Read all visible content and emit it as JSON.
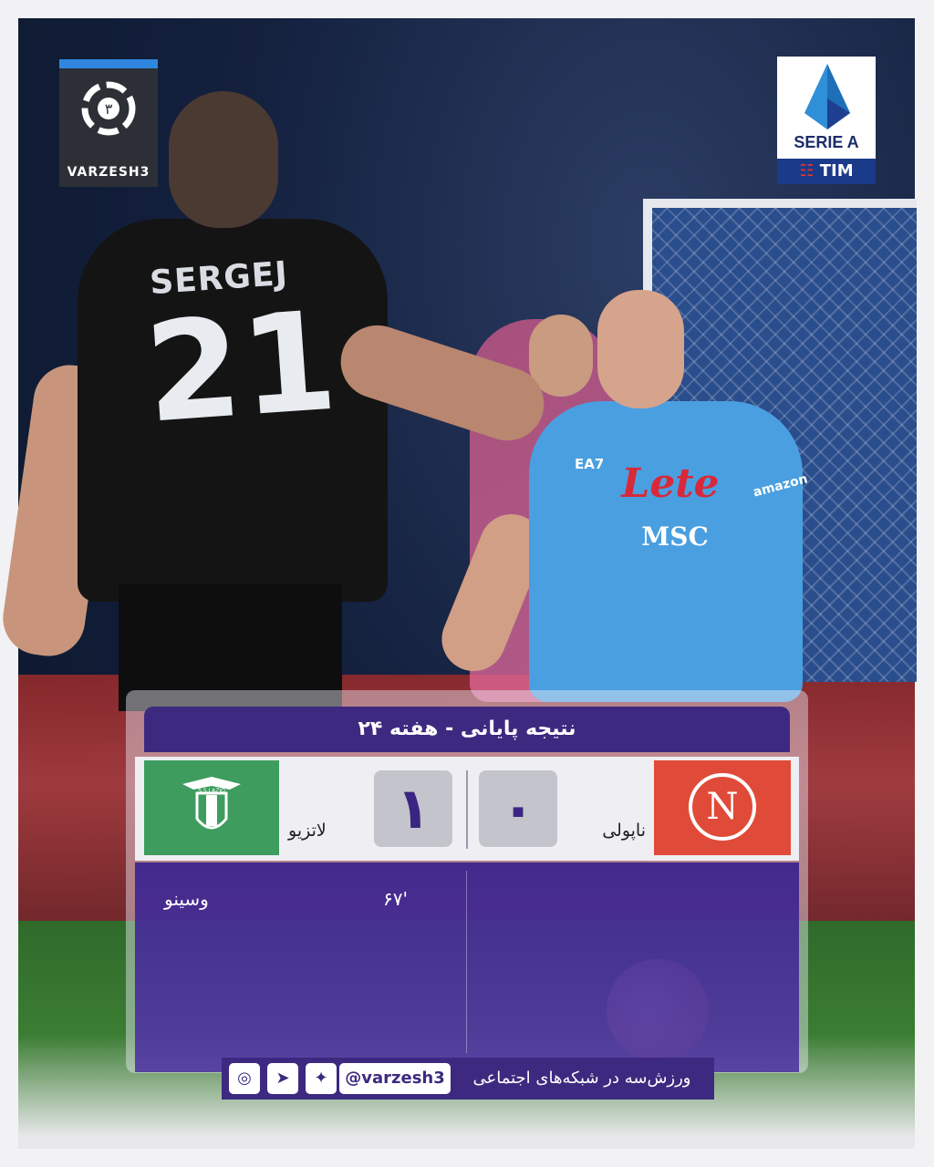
{
  "brand": {
    "logo_text": "VARZESH3",
    "logo_mark_digit": "٣"
  },
  "league": {
    "name": "SERIE A",
    "sponsor": "TIM"
  },
  "photo": {
    "player_name": "SERGEJ",
    "player_number": "21",
    "home_shirt_sponsor": "Lete",
    "home_shirt_sponsor2": "MSC",
    "home_shirt_brand": "EA7",
    "home_sleeve": "amazon"
  },
  "match": {
    "title": "نتیجه پایانی - هفته ۲۴",
    "home_team": "ناپولی",
    "away_team": "لاتزیو",
    "home_score": "۰",
    "away_score": "۱",
    "away_logo_text": "S.S.LAZIO",
    "events": [
      {
        "minute": "۶۷'",
        "player": "وسینو"
      }
    ]
  },
  "social": {
    "handle": "@varzesh3",
    "text": "ورزش‌سه در شبکه‌های اجتماعی",
    "icons": [
      "instagram-icon",
      "telegram-icon",
      "twitter-icon"
    ]
  },
  "colors": {
    "accent": "#3d2a80",
    "home": "#e04b39",
    "away": "#3e9c5e"
  }
}
